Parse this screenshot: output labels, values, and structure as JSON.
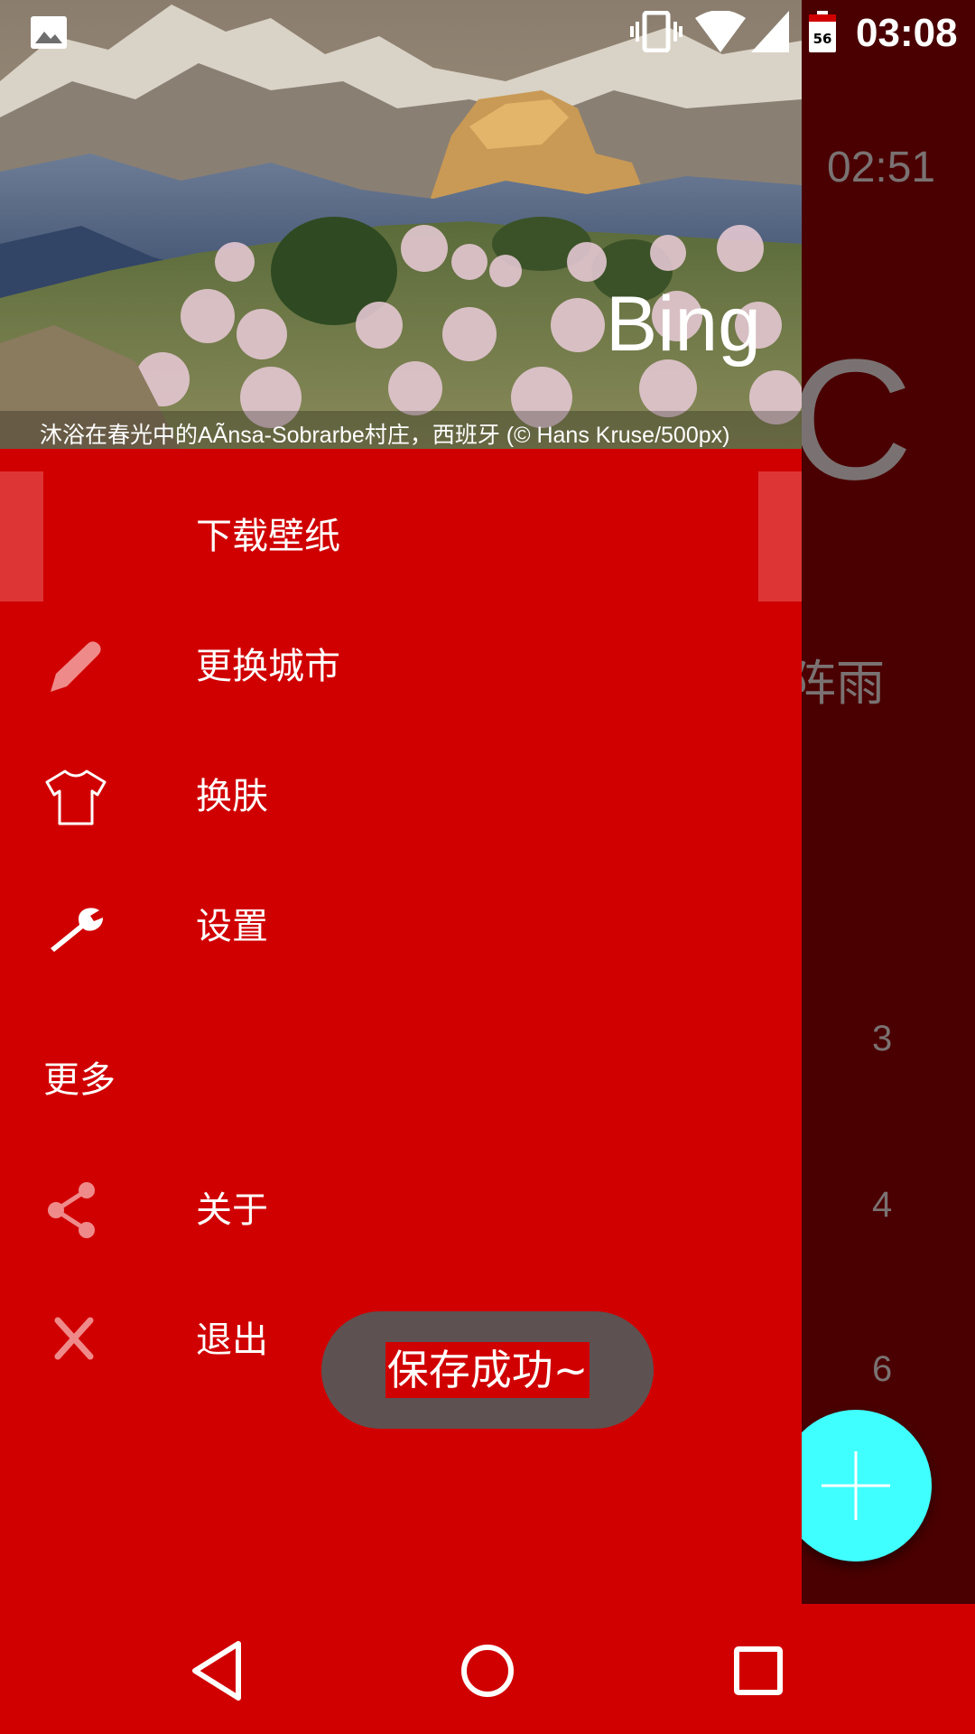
{
  "status_bar": {
    "time": "03:08",
    "battery_level": "56",
    "icons": [
      "image-notification-icon",
      "vibrate-icon",
      "wifi-icon",
      "cell-signal-icon",
      "battery-icon"
    ]
  },
  "background_app": {
    "time": "02:51",
    "temp_unit": "C",
    "weather": "阵雨",
    "forecast_numbers": [
      "3",
      "4",
      "6"
    ],
    "fab_icon": "plus-icon",
    "accent_color": "#40ffff"
  },
  "drawer": {
    "header": {
      "title": "Bing",
      "caption": "沐浴在春光中的AÃnsa-Sobrarbe村庄，西班牙 (© Hans Kruse/500px)"
    },
    "items": [
      {
        "label": "下载壁纸",
        "icon": "none"
      },
      {
        "label": "更换城市",
        "icon": "pencil-icon"
      },
      {
        "label": "换肤",
        "icon": "tshirt-icon"
      },
      {
        "label": "设置",
        "icon": "wrench-icon"
      }
    ],
    "section_title": "更多",
    "more_items": [
      {
        "label": "关于",
        "icon": "share-icon"
      },
      {
        "label": "退出",
        "icon": "close-icon"
      }
    ],
    "color": "#d10000"
  },
  "toast": {
    "message": "保存成功~"
  },
  "nav_bar": {
    "buttons": [
      "back-icon",
      "home-icon",
      "recents-icon"
    ]
  }
}
